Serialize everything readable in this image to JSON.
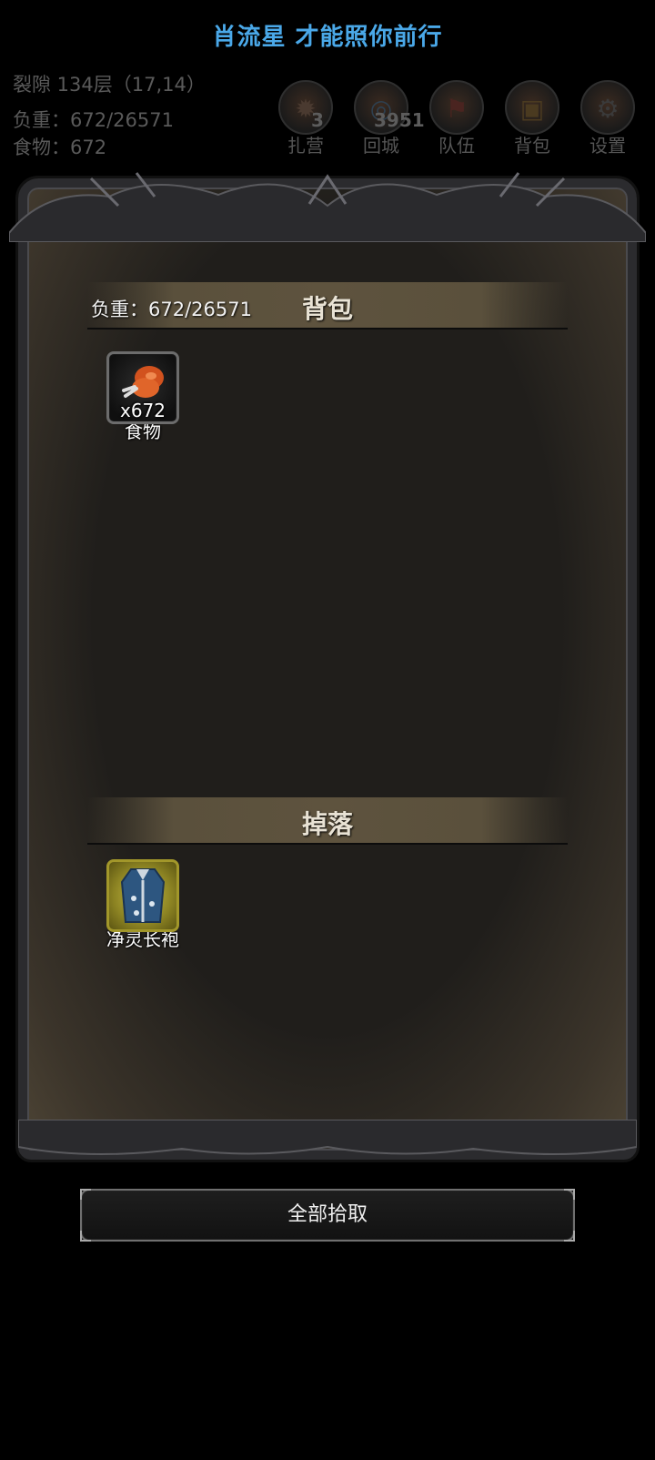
{
  "banner": "肖流星 才能照你前行",
  "status": {
    "location": "裂隙 134层（17,14）",
    "load": "负重：672/26571",
    "food": "食物：672"
  },
  "top_menu": [
    {
      "label": "扎营",
      "icon": "campfire-icon",
      "badge": "3"
    },
    {
      "label": "回城",
      "icon": "portal-icon",
      "badge": "3951"
    },
    {
      "label": "队伍",
      "icon": "team-icon",
      "badge": ""
    },
    {
      "label": "背包",
      "icon": "backpack-icon",
      "badge": ""
    },
    {
      "label": "设置",
      "icon": "gear-icon",
      "badge": ""
    }
  ],
  "bag": {
    "title": "背包",
    "load": "负重：672/26571",
    "items": [
      {
        "name": "食物",
        "count": "x672",
        "icon": "meat-drumstick-icon",
        "rarity": "common"
      }
    ]
  },
  "drops": {
    "title": "掉落",
    "items": [
      {
        "name": "净灵长袍",
        "count": "",
        "icon": "robe-icon",
        "rarity": "rare"
      }
    ]
  },
  "pick_all_label": "全部拾取",
  "colors": {
    "banner": "#4aa8e8",
    "frame": "#2b2b2e",
    "panel": "#201e1b",
    "rare_border": "#a2972a"
  }
}
